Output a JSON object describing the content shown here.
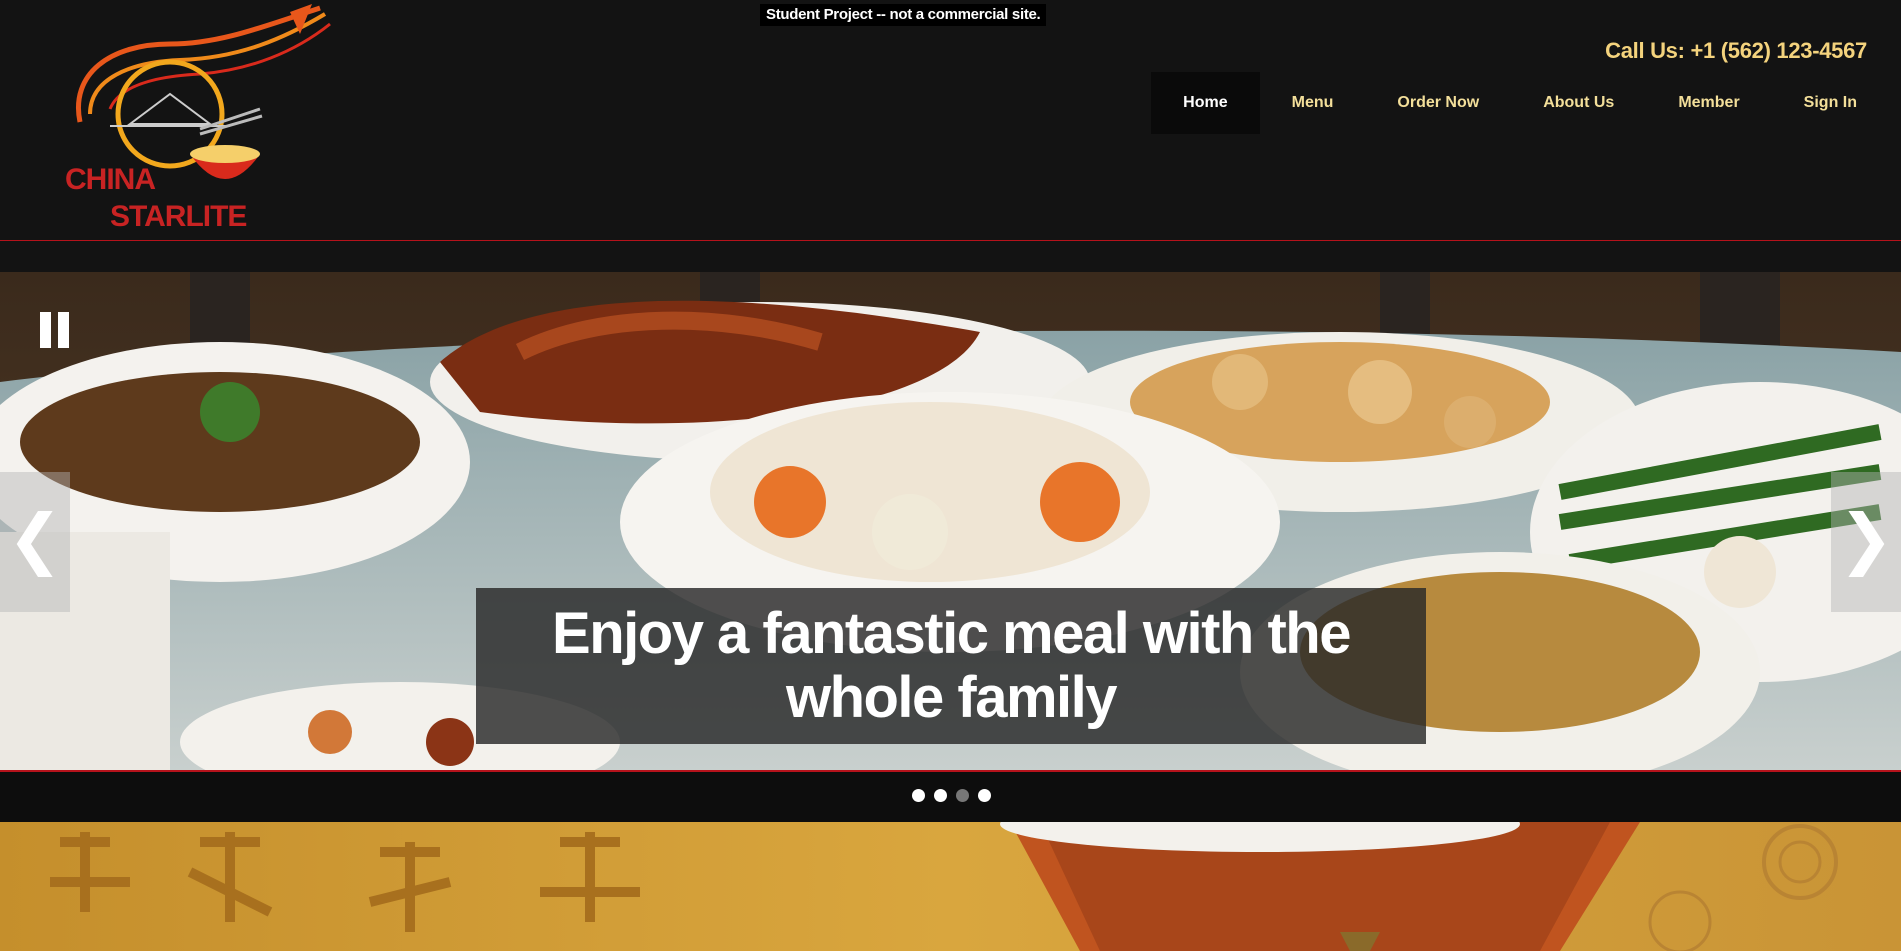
{
  "notice": "Student Project -- not a commercial site.",
  "brand": {
    "logo_line1": "CHINA",
    "logo_line2": "STARLITE"
  },
  "contact": {
    "call_text": "Call Us: +1 (562) 123-4567"
  },
  "nav": {
    "items": [
      {
        "label": "Home",
        "active": true
      },
      {
        "label": "Menu"
      },
      {
        "label": "Order Now"
      },
      {
        "label": "About Us"
      },
      {
        "label": "Member"
      },
      {
        "label": "Sign In"
      }
    ]
  },
  "slider": {
    "caption_line1": "Enjoy a fantastic meal with the",
    "caption_line2": "whole family",
    "prev_symbol": "❮",
    "next_symbol": "❯",
    "slide_count": 4,
    "active_slide": 3
  },
  "colors": {
    "background": "#131313",
    "accent_red": "#b5121b",
    "nav_text": "#f3df9a",
    "call_text": "#f4d37d"
  }
}
